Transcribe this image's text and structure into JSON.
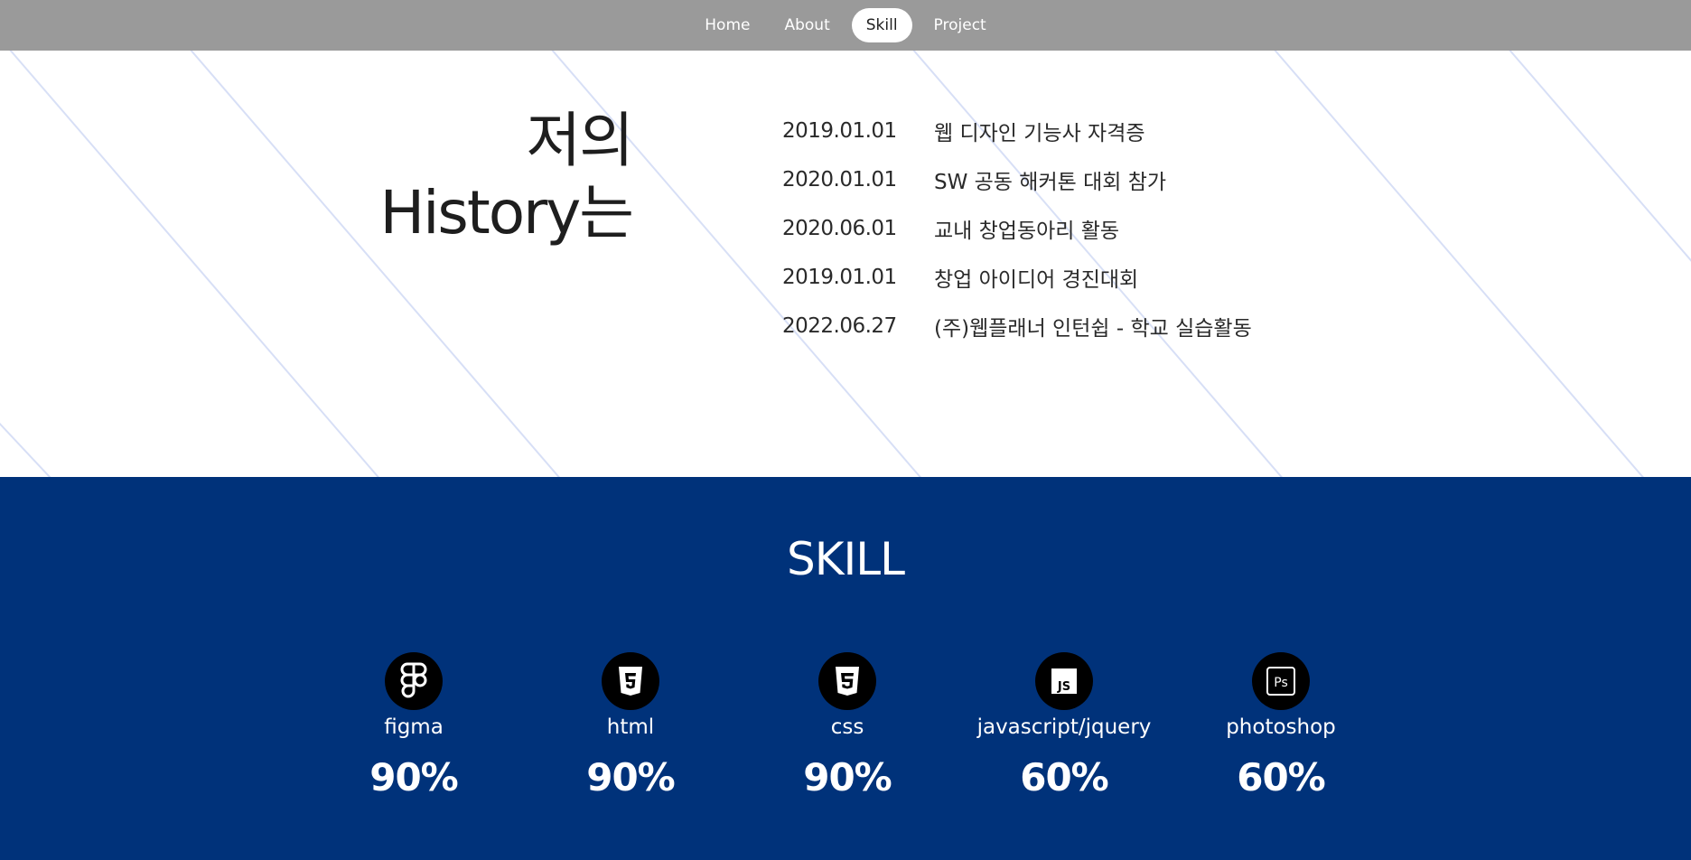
{
  "nav": {
    "items": [
      {
        "label": "Home",
        "active": false
      },
      {
        "label": "About",
        "active": false
      },
      {
        "label": "Skill",
        "active": true
      },
      {
        "label": "Project",
        "active": false
      }
    ]
  },
  "history": {
    "title_line1": "저의",
    "title_line2": "History는",
    "rows": [
      {
        "date": "2019.01.01",
        "text": "웹 디자인 기능사 자격증"
      },
      {
        "date": "2020.01.01",
        "text": "SW 공동 해커톤 대회 참가"
      },
      {
        "date": "2020.06.01",
        "text": "교내 창업동아리 활동"
      },
      {
        "date": "2019.01.01",
        "text": "창업 아이디어 경진대회"
      },
      {
        "date": "2022.06.27",
        "text": "(주)웹플래너 인턴쉽 - 학교 실습활동"
      }
    ]
  },
  "skill": {
    "title": "SKILL",
    "background": "#00327a",
    "items": [
      {
        "name": "figma",
        "percent": "90%",
        "icon": "figma-icon"
      },
      {
        "name": "html",
        "percent": "90%",
        "icon": "html5-icon"
      },
      {
        "name": "css",
        "percent": "90%",
        "icon": "css3-icon"
      },
      {
        "name": "javascript/jquery",
        "percent": "60%",
        "icon": "js-icon"
      },
      {
        "name": "photoshop",
        "percent": "60%",
        "icon": "photoshop-icon"
      }
    ]
  }
}
